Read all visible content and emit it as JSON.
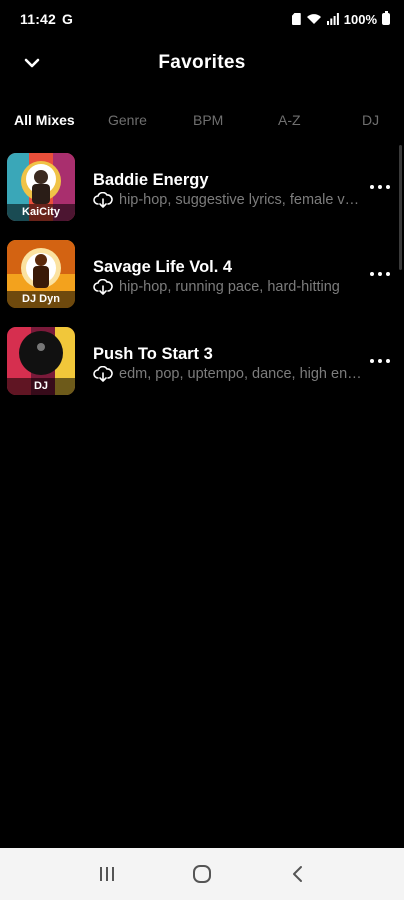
{
  "status_bar": {
    "time": "11:42",
    "carrier_icon": "G",
    "battery_percent": "100%",
    "icons": [
      "sim-icon",
      "wifi-icon",
      "signal-icon",
      "battery-icon"
    ]
  },
  "header": {
    "title": "Favorites",
    "back_icon": "chevron-down-icon"
  },
  "tabs": [
    {
      "label": "All Mixes",
      "active": true
    },
    {
      "label": "Genre",
      "active": false
    },
    {
      "label": "BPM",
      "active": false
    },
    {
      "label": "A-Z",
      "active": false
    },
    {
      "label": "DJ",
      "active": false
    }
  ],
  "mixes": [
    {
      "title": "Baddie Energy",
      "tags": "hip-hop, suggestive lyrics, female vocals",
      "dj_label": "KaiCity",
      "icon": "cloud-download-icon",
      "art_colors": [
        "#e94f3b",
        "#3aa7b8",
        "#f0c347",
        "#a92f6e"
      ]
    },
    {
      "title": "Savage Life Vol. 4",
      "tags": "hip-hop, running pace, hard-hitting",
      "dj_label": "DJ Dyn",
      "icon": "cloud-download-icon",
      "art_colors": [
        "#f3a21d",
        "#d36312",
        "#fbe2a0",
        "#5b2a0c"
      ]
    },
    {
      "title": "Push To Start 3",
      "tags": "edm, pop, uptempo, dance, high energy",
      "dj_label": "DJ",
      "icon": "cloud-download-icon",
      "art_colors": [
        "#d62f4f",
        "#f1c73a",
        "#7a1a3a",
        "#111111"
      ]
    }
  ],
  "nav_bar": {
    "recents_icon": "recents-icon",
    "home_icon": "home-icon",
    "back_icon": "back-icon"
  }
}
